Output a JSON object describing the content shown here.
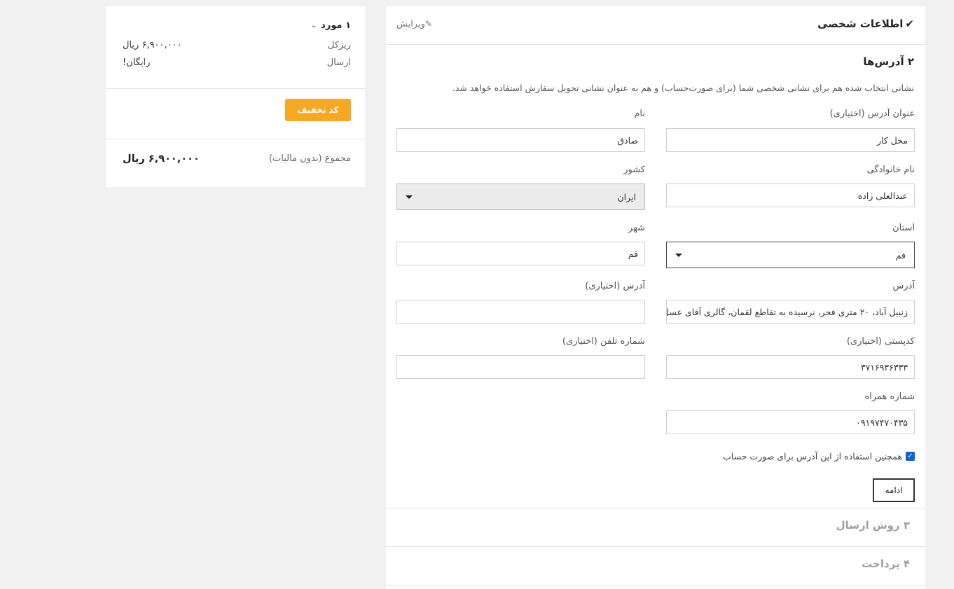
{
  "step1": {
    "title": "اطلاعات شخصی",
    "edit_label": "ویرایش"
  },
  "step2": {
    "title": "۲ آدرس‌ها",
    "intro": "نشانی انتخاب شده هم برای نشانی شخصی شما (برای صورت‌حساب) و هم به عنوان نشانی تحویل سفارش استفاده خواهد شد.",
    "fields": {
      "alias": {
        "label": "عنوان آدرس (اختیاری)",
        "value": "محل کار"
      },
      "firstname": {
        "label": "نام",
        "value": "صادق"
      },
      "lastname": {
        "label": "نام خانوادگی",
        "value": "عبدالعلی زاده"
      },
      "country": {
        "label": "کشور",
        "value": "ایران"
      },
      "state": {
        "label": "استان",
        "value": "قم"
      },
      "city": {
        "label": "شهر",
        "value": "قم"
      },
      "address1": {
        "label": "آدرس",
        "value": "زنبیل آباد، ۲۰ متری فجر، نرسیده به تقاطع لقمان، گالری آقای عسل"
      },
      "address2": {
        "label": "آدرس (اختیاری)",
        "value": ""
      },
      "postcode": {
        "label": "کدپستی (اختیاری)",
        "value": "۳۷۱۶۹۳۶۳۳۳"
      },
      "phone": {
        "label": "شماره تلفن (اختیاری)",
        "value": ""
      },
      "mobile": {
        "label": "شماره همراه",
        "value": "۰۹۱۹۷۴۷۰۴۳۵"
      }
    },
    "use_for_invoice": "همچنین استفاده از این آدرس برای صورت حساب",
    "continue_label": "ادامه"
  },
  "step3": {
    "title": "۳ روش ارسال"
  },
  "step4": {
    "title": "۴ پرداخت"
  },
  "summary": {
    "count": "۱ مورد",
    "subtotal_label": "ریزکل",
    "subtotal_value": "۶,۹۰۰,۰۰۰ ریال",
    "shipping_label": "ارسال",
    "shipping_value": "رایگان!",
    "discount_label": "کد تخفیف",
    "total_label": "مجموع (بدون مالیات)",
    "total_value": "۶,۹۰۰,۰۰۰ ریال"
  },
  "colors": {
    "accent": "#f7a721",
    "checkbox": "#0a64d8"
  }
}
